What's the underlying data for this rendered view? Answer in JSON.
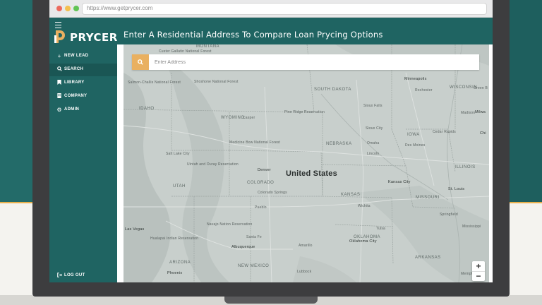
{
  "browser": {
    "url": "https://www.getprycer.com"
  },
  "app": {
    "logo_text": "PRYCER",
    "brand_color": "#1f6462",
    "accent_color": "#e9b060"
  },
  "sidebar": {
    "items": [
      {
        "icon": "plus-icon",
        "label": "NEW LEAD"
      },
      {
        "icon": "search-icon",
        "label": "SEARCH",
        "active": true
      },
      {
        "icon": "bookmark-icon",
        "label": "LIBRARY"
      },
      {
        "icon": "building-icon",
        "label": "COMPANY"
      },
      {
        "icon": "gear-icon",
        "label": "ADMIN"
      }
    ],
    "logout_label": "LOG OUT"
  },
  "header": {
    "title": "Enter A Residential Address To Compare Loan Prycing Options"
  },
  "search": {
    "placeholder": "Enter Address"
  },
  "map": {
    "country_label": "United States",
    "states": [
      "MONTANA",
      "SOUTH DAKOTA",
      "IDAHO",
      "WYOMING",
      "NEBRASKA",
      "UTAH",
      "COLORADO",
      "KANSAS",
      "IOWA",
      "ILLINOIS",
      "MISSOURI",
      "OKLAHOMA",
      "ARIZONA",
      "NEW MEXICO",
      "ARKANSAS",
      "WISCONSIN"
    ],
    "cities": [
      "Minneapolis",
      "Denver",
      "Kansas City",
      "St. Louis",
      "Las Vegas",
      "Albuquerque",
      "Phoenix",
      "Oklahoma City",
      "Casper",
      "Colorado Springs",
      "Tulsa",
      "Milwa",
      "Chi",
      "Salt Lake City",
      "Madison",
      "Des Moines",
      "Omaha",
      "Lincoln",
      "Cedar Rapids",
      "Amarillo",
      "Lubbock",
      "Wichita",
      "Pueblo",
      "Santa Fe",
      "Springfield",
      "Sioux City",
      "Green B",
      "Rochester",
      "Sioux Falls",
      "Memphis"
    ],
    "areas": [
      "Medicine Bow National Forest",
      "Custer Gallatin National Forest",
      "Shoshone National Forest",
      "Uintah and Ouray Reservation",
      "Pine Ridge Reservation",
      "Navajo Nation Reservation",
      "Hualapai Indian Reservation",
      "Salmon-Challis National Forest",
      "Mississippi"
    ],
    "zoom_in": "+",
    "zoom_out": "−"
  }
}
